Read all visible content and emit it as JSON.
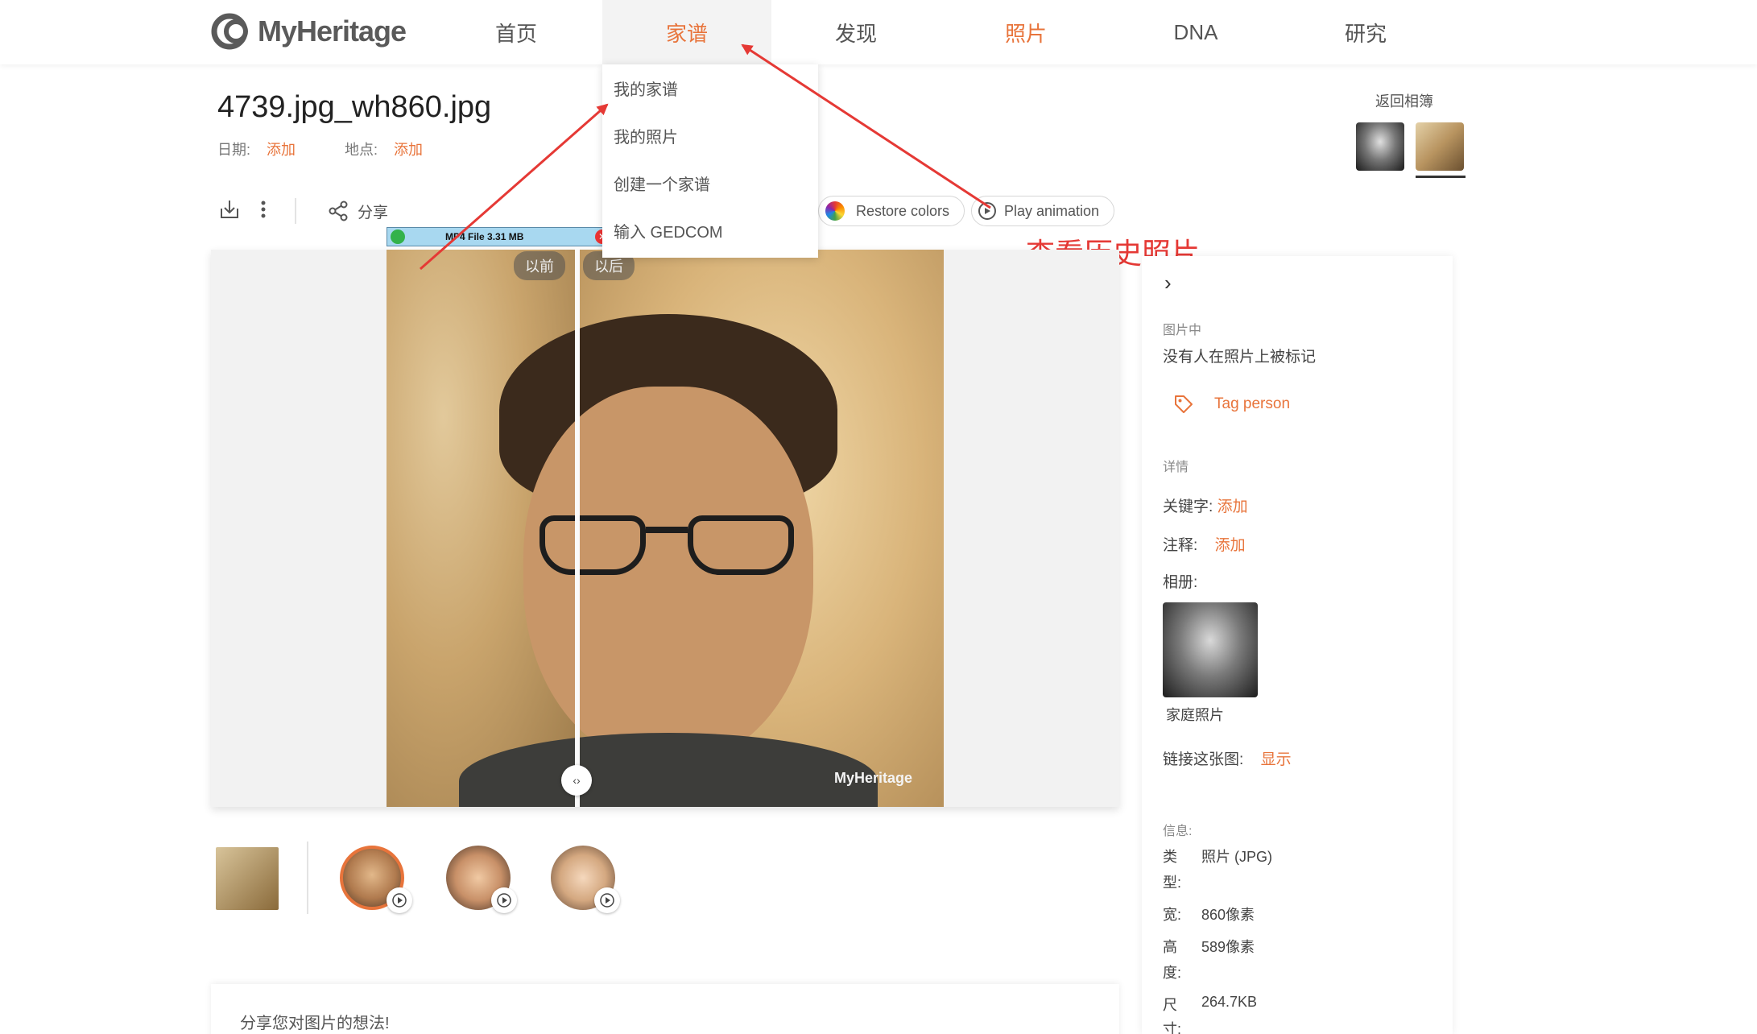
{
  "logo": {
    "text": "MyHeritage"
  },
  "nav": [
    {
      "label": "首页"
    },
    {
      "label": "家谱"
    },
    {
      "label": "发现"
    },
    {
      "label": "照片"
    },
    {
      "label": "DNA"
    },
    {
      "label": "研究"
    }
  ],
  "dropdown": [
    {
      "label": "我的家谱"
    },
    {
      "label": "我的照片"
    },
    {
      "label": "创建一个家谱"
    },
    {
      "label": "输入 GEDCOM"
    }
  ],
  "photo": {
    "title": "4739.jpg_wh860.jpg",
    "date_label": "日期:",
    "date_link": "添加",
    "place_label": "地点:",
    "place_link": "添加",
    "share_label": "分享",
    "before_label": "以前",
    "after_label": "以后",
    "watermark": "MyHeritage"
  },
  "actions": {
    "restore_colors": "Restore colors",
    "play_animation": "Play animation"
  },
  "annotation": {
    "text": "查看历史照片",
    "color": "#e53935"
  },
  "download_bar": {
    "text": "MP4 File 3.31 MB"
  },
  "album": {
    "back_label": "返回相簿"
  },
  "panel": {
    "in_photo_label": "图片中",
    "no_tags": "没有人在照片上被标记",
    "tag_person": "Tag person",
    "details_label": "详情",
    "keywords_label": "关键字:",
    "keywords_link": "添加",
    "notes_label": "注释:",
    "notes_link": "添加",
    "album_label": "相册:",
    "album_name": "家庭照片",
    "link_label": "链接这张图:",
    "link_action": "显示",
    "info_label": "信息:",
    "info": {
      "type_key_1": "类",
      "type_key_2": "型:",
      "type_val": "照片 (JPG)",
      "width_key": "宽:",
      "width_val": "860像素",
      "height_key_1": "高",
      "height_key_2": "度:",
      "height_val": "589像素",
      "size_key_1": "尺",
      "size_key_2": "寸:",
      "size_val": "264.7KB"
    }
  },
  "comment": {
    "prompt": "分享您对图片的想法!"
  },
  "colors": {
    "accent": "#e8743b",
    "annotation": "#e53935"
  }
}
